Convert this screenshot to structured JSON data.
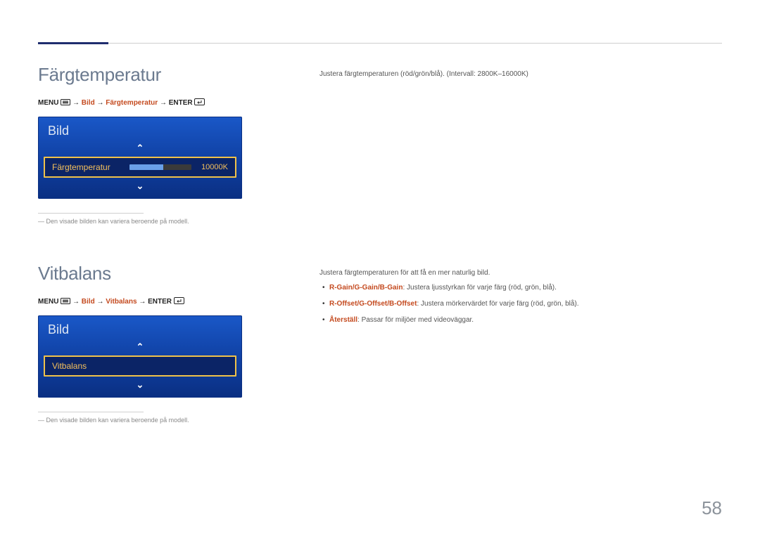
{
  "pageNumber": "58",
  "section1": {
    "title": "Färgtemperatur",
    "menuPath": {
      "menuLabel": "MENU",
      "segBild": "Bild",
      "segTarget": "Färgtemperatur",
      "enterLabel": "ENTER",
      "arrow": "→"
    },
    "osd": {
      "panelTitle": "Bild",
      "itemLabel": "Färgtemperatur",
      "itemValue": "10000K"
    },
    "footnote": "Den visade bilden kan variera beroende på modell.",
    "bodyIntro": "Justera färgtemperaturen (röd/grön/blå). (Intervall: 2800K–16000K)"
  },
  "section2": {
    "title": "Vitbalans",
    "menuPath": {
      "menuLabel": "MENU",
      "segBild": "Bild",
      "segTarget": "Vitbalans",
      "enterLabel": "ENTER",
      "arrow": "→"
    },
    "osd": {
      "panelTitle": "Bild",
      "itemLabel": "Vitbalans"
    },
    "footnote": "Den visade bilden kan variera beroende på modell.",
    "bodyIntro": "Justera färgtemperaturen för att få en mer naturlig bild.",
    "bullets": [
      {
        "term": "R-Gain/G-Gain/B-Gain",
        "rest": ": Justera ljusstyrkan för varje färg (röd, grön, blå)."
      },
      {
        "term": "R-Offset/G-Offset/B-Offset",
        "rest": ": Justera mörkervärdet för varje färg (röd, grön, blå)."
      },
      {
        "term": "Återställ",
        "rest": ": Passar för miljöer med videoväggar."
      }
    ]
  }
}
